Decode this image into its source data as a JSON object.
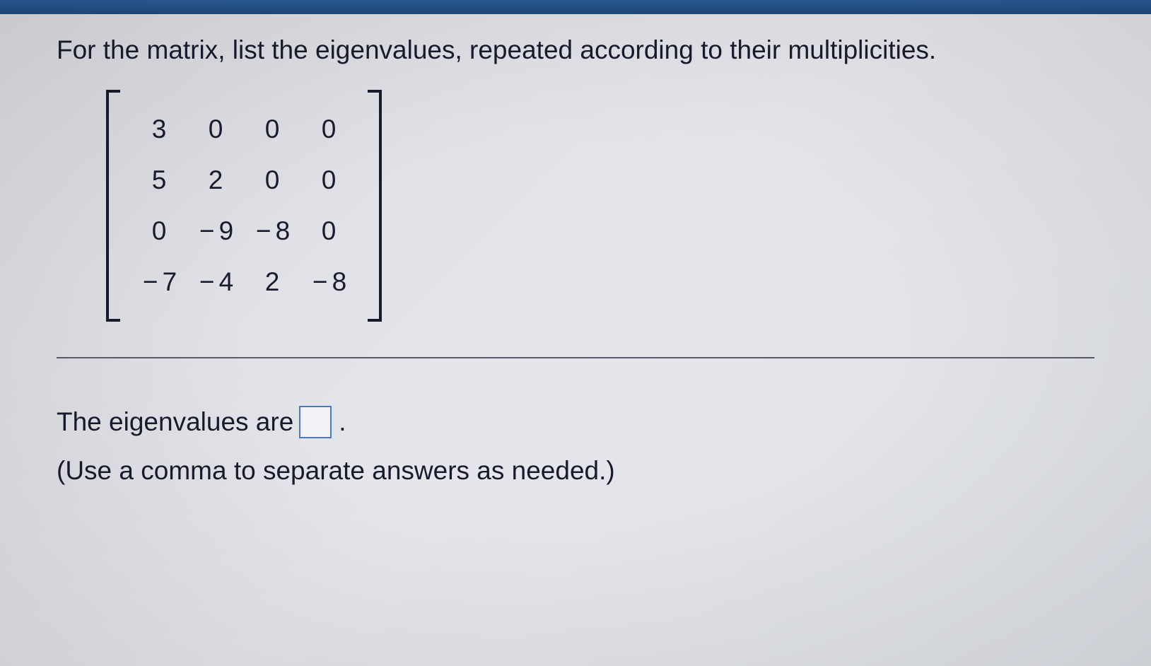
{
  "question": "For the matrix, list the eigenvalues, repeated according to their multiplicities.",
  "matrix": {
    "r0c0": "3",
    "r0c1": "0",
    "r0c2": "0",
    "r0c3": "0",
    "r1c0": "5",
    "r1c1": "2",
    "r1c2": "0",
    "r1c3": "0",
    "r2c0": "0",
    "r2c1": "− 9",
    "r2c2": "− 8",
    "r2c3": "0",
    "r3c0": "− 7",
    "r3c1": "− 4",
    "r3c2": "2",
    "r3c3": "− 8"
  },
  "answer": {
    "prefix": "The eigenvalues are",
    "period": ".",
    "hint": "(Use a comma to separate answers as needed.)"
  }
}
